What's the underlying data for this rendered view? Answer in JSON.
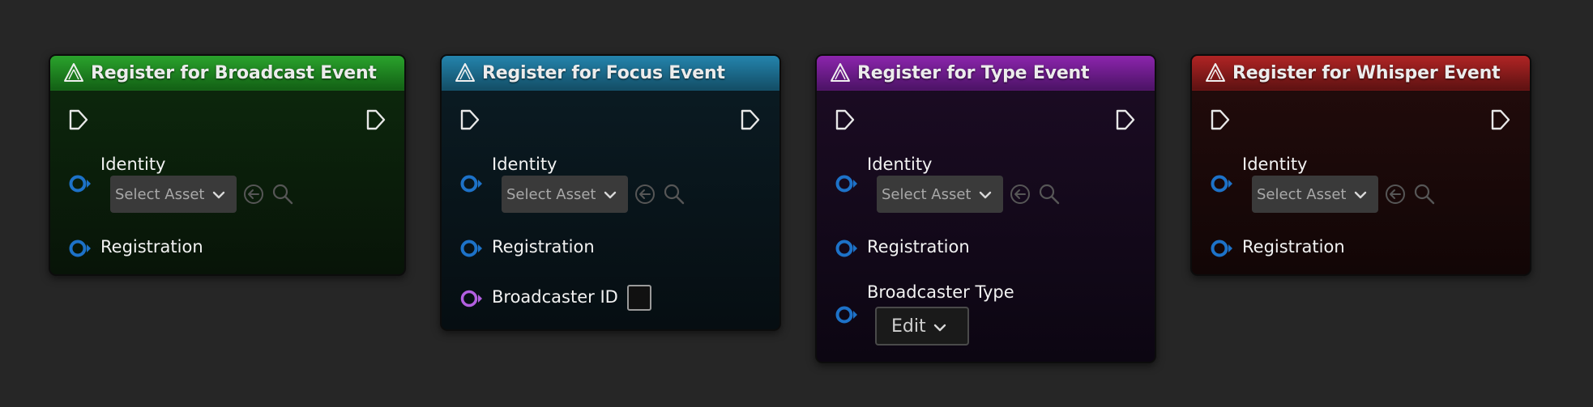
{
  "nodes": [
    {
      "title": "Register for Broadcast Event",
      "header_color": "#1f8a22",
      "identity_label": "Identity",
      "select_placeholder": "Select Asset",
      "registration_label": "Registration"
    },
    {
      "title": "Register for Focus Event",
      "header_color": "#1f6f92",
      "identity_label": "Identity",
      "select_placeholder": "Select Asset",
      "registration_label": "Registration",
      "extra_label": "Broadcaster ID"
    },
    {
      "title": "Register for Type Event",
      "header_color": "#7a1f9a",
      "identity_label": "Identity",
      "select_placeholder": "Select Asset",
      "registration_label": "Registration",
      "extra_label": "Broadcaster Type",
      "edit_label": "Edit"
    },
    {
      "title": "Register for Whisper Event",
      "header_color": "#9a1f1f",
      "identity_label": "Identity",
      "select_placeholder": "Select Asset",
      "registration_label": "Registration"
    }
  ],
  "colors": {
    "background": "#262626",
    "struct_pin": "#1d72c8",
    "int_pin": "#b25fe0",
    "exec_pin": "#e8e8e8"
  },
  "icons": {
    "node_icon": "function-icon",
    "exec": "exec-pin-icon",
    "browse": "browse-back-icon",
    "search": "magnifier-icon",
    "chevron": "chevron-down-icon"
  }
}
